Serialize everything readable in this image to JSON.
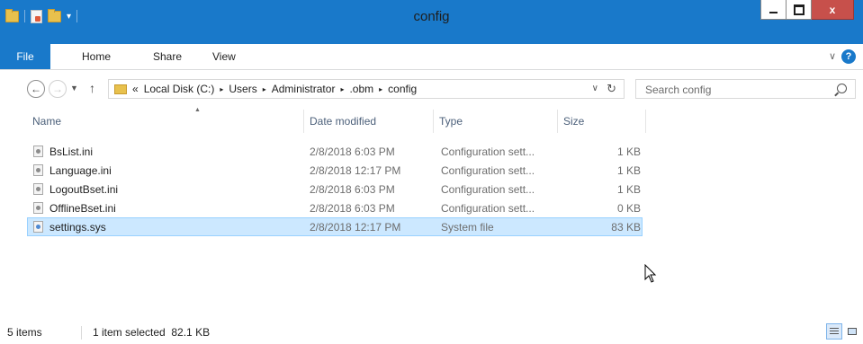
{
  "window": {
    "title": "config"
  },
  "title_buttons": {
    "minimize": "minimize-icon",
    "maximize": "maximize-icon",
    "close": "x"
  },
  "ribbon": {
    "tabs": [
      "File",
      "Home",
      "Share",
      "View"
    ],
    "expand_icon": "chevron-down-icon",
    "help_label": "?"
  },
  "address_bar": {
    "overflow": "«",
    "crumbs": [
      "Local Disk (C:)",
      "Users",
      "Administrator",
      ".obm",
      "config"
    ],
    "separator": "▸"
  },
  "search": {
    "placeholder": "Search config"
  },
  "columns": [
    "Name",
    "Date modified",
    "Type",
    "Size"
  ],
  "files": [
    {
      "name": "BsList.ini",
      "date": "2/8/2018 6:03 PM",
      "type": "Configuration sett...",
      "size": "1 KB",
      "icon": "config-file-icon"
    },
    {
      "name": "Language.ini",
      "date": "2/8/2018 12:17 PM",
      "type": "Configuration sett...",
      "size": "1 KB",
      "icon": "config-file-icon"
    },
    {
      "name": "LogoutBset.ini",
      "date": "2/8/2018 6:03 PM",
      "type": "Configuration sett...",
      "size": "1 KB",
      "icon": "config-file-icon"
    },
    {
      "name": "OfflineBset.ini",
      "date": "2/8/2018 6:03 PM",
      "type": "Configuration sett...",
      "size": "0 KB",
      "icon": "config-file-icon"
    },
    {
      "name": "settings.sys",
      "date": "2/8/2018 12:17 PM",
      "type": "System file",
      "size": "83 KB",
      "icon": "system-file-icon",
      "selected": true
    }
  ],
  "status": {
    "item_count": "5 items",
    "selection": "1 item selected  82.1 KB"
  },
  "colors": {
    "accent": "#1979ca",
    "selection": "#cce8ff",
    "close": "#c7504b"
  }
}
